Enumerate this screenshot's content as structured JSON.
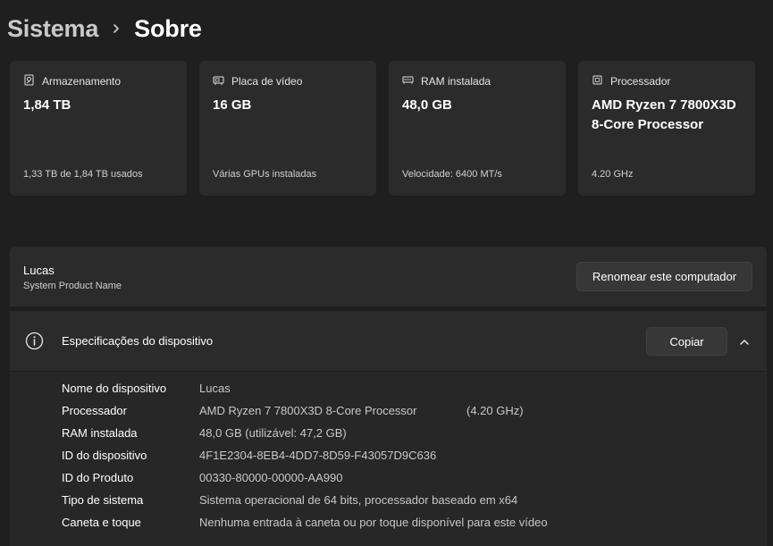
{
  "breadcrumb": {
    "parent": "Sistema",
    "current": "Sobre"
  },
  "cards": [
    {
      "label": "Armazenamento",
      "icon": "storage-icon",
      "value": "1,84 TB",
      "sub": "1,33 TB de 1,84 TB usados"
    },
    {
      "label": "Placa de vídeo",
      "icon": "gpu-icon",
      "value": "16 GB",
      "sub": "Várias GPUs instaladas"
    },
    {
      "label": "RAM instalada",
      "icon": "ram-icon",
      "value": "48,0 GB",
      "sub": "Velocidade: 6400 MT/s"
    },
    {
      "label": "Processador",
      "icon": "cpu-icon",
      "value": "AMD Ryzen 7 7800X3D 8-Core Processor",
      "sub": "4.20 GHz"
    }
  ],
  "device": {
    "name": "Lucas",
    "model": "System Product Name",
    "rename_label": "Renomear este computador"
  },
  "specs": {
    "title": "Especificações do dispositivo",
    "copy_label": "Copiar",
    "rows": [
      {
        "label": "Nome do dispositivo",
        "value": "Lucas"
      },
      {
        "label": "Processador",
        "value": "AMD Ryzen 7 7800X3D 8-Core Processor",
        "extra": "(4.20 GHz)"
      },
      {
        "label": "RAM instalada",
        "value": "48,0 GB (utilizável: 47,2 GB)"
      },
      {
        "label": "ID do dispositivo",
        "value": "4F1E2304-8EB4-4DD7-8D59-F43057D9C636"
      },
      {
        "label": "ID do Produto",
        "value": "00330-80000-00000-AA990"
      },
      {
        "label": "Tipo de sistema",
        "value": "Sistema operacional de 64 bits, processador baseado em x64"
      },
      {
        "label": "Caneta e toque",
        "value": "Nenhuma entrada à caneta ou por toque disponível para este vídeo"
      }
    ]
  },
  "colors": {
    "background": "#1f1f1f",
    "card": "#2b2b2b",
    "button": "#373737",
    "text_secondary": "#c8c8c8"
  }
}
